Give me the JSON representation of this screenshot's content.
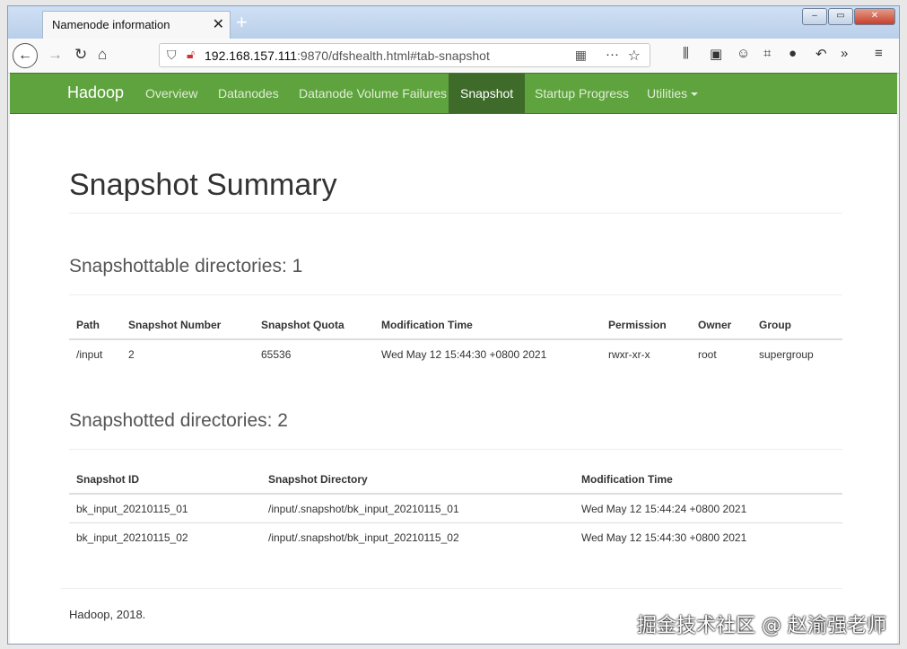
{
  "browser": {
    "tab_title": "Namenode information",
    "tab_close": "✕",
    "new_tab": "+",
    "url_host": "192.168.157.111",
    "url_rest": ":9870/dfshealth.html#tab-snapshot",
    "more_label": "···",
    "window_buttons": [
      "‒",
      "▭",
      "✕"
    ]
  },
  "navbar": {
    "brand": "Hadoop",
    "items": [
      "Overview",
      "Datanodes",
      "Datanode Volume Failures",
      "Snapshot",
      "Startup Progress",
      "Utilities"
    ],
    "active": "Snapshot"
  },
  "page": {
    "title": "Snapshot Summary",
    "snapshottable": {
      "heading": "Snapshottable directories: 1",
      "columns": [
        "Path",
        "Snapshot Number",
        "Snapshot Quota",
        "Modification Time",
        "Permission",
        "Owner",
        "Group"
      ],
      "rows": [
        [
          "/input",
          "2",
          "65536",
          "Wed May 12 15:44:30 +0800 2021",
          "rwxr-xr-x",
          "root",
          "supergroup"
        ]
      ]
    },
    "snapshotted": {
      "heading": "Snapshotted directories: 2",
      "columns": [
        "Snapshot ID",
        "Snapshot Directory",
        "Modification Time"
      ],
      "rows": [
        [
          "bk_input_20210115_01",
          "/input/.snapshot/bk_input_20210115_01",
          "Wed May 12 15:44:24 +0800 2021"
        ],
        [
          "bk_input_20210115_02",
          "/input/.snapshot/bk_input_20210115_02",
          "Wed May 12 15:44:30 +0800 2021"
        ]
      ]
    },
    "footer": "Hadoop, 2018.",
    "watermark": "掘金技术社区 @ 赵渝强老师"
  }
}
